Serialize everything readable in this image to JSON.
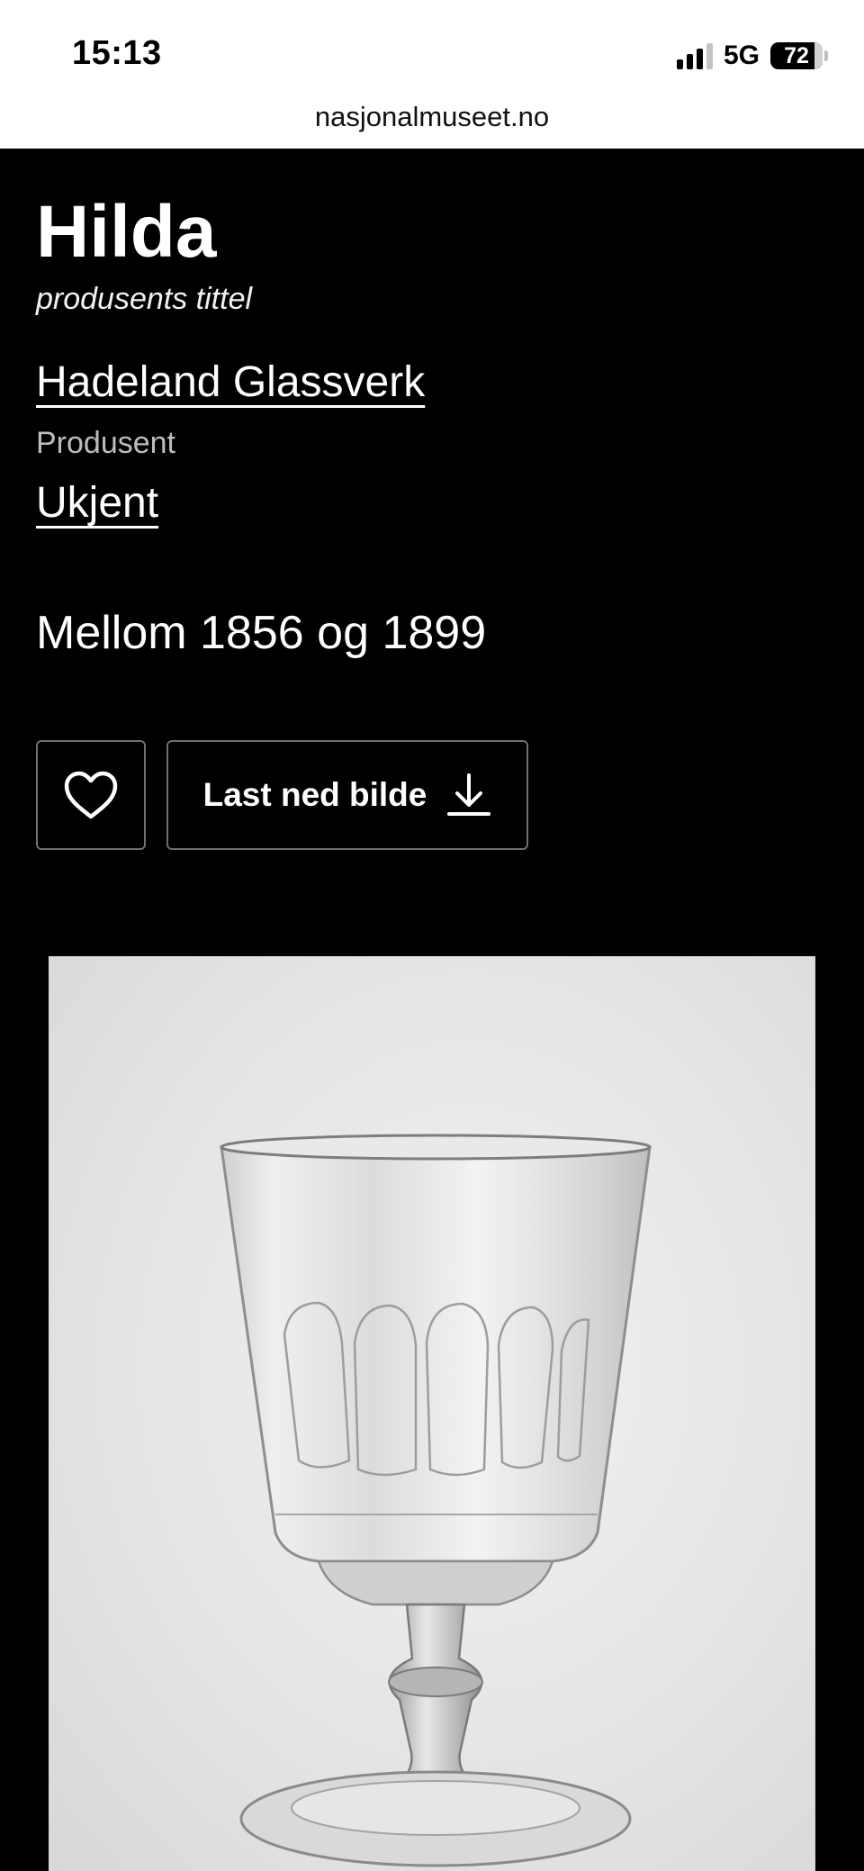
{
  "status_bar": {
    "time": "15:13",
    "network": "5G",
    "battery": "72"
  },
  "browser": {
    "url": "nasjonalmuseet.no"
  },
  "artwork": {
    "title": "Hilda",
    "title_note": "produsents tittel",
    "maker": "Hadeland Glassverk",
    "maker_role": "Produsent",
    "maker2": "Ukjent",
    "dating": "Mellom 1856 og 1899"
  },
  "actions": {
    "favorite_icon": "heart-icon",
    "download_label": "Last ned bilde",
    "download_icon": "download-icon"
  },
  "image": {
    "subject": "wine-glass-icon",
    "background_color": "#e6e6e7"
  }
}
